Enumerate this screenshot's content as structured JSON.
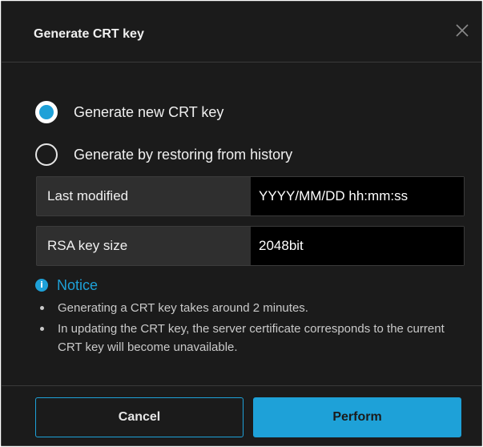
{
  "dialog": {
    "title": "Generate CRT key",
    "close_icon": "close-icon",
    "options": [
      {
        "label": "Generate new CRT key",
        "selected": true
      },
      {
        "label": "Generate by restoring from history",
        "selected": false
      }
    ],
    "fields": [
      {
        "label": "Last modified",
        "value": "YYYY/MM/DD hh:mm:ss"
      },
      {
        "label": "RSA key size",
        "value": "2048bit"
      }
    ],
    "notice": {
      "icon": "info-icon",
      "icon_glyph": "i",
      "title": "Notice",
      "items": [
        "Generating a CRT key takes around 2 minutes.",
        "In updating the CRT key, the server certificate corresponds to the current CRT key will become unavailable."
      ]
    },
    "buttons": {
      "cancel": "Cancel",
      "perform": "Perform"
    }
  },
  "colors": {
    "accent": "#1ea1d8",
    "background": "#1b1b1b",
    "field_label_bg": "#2f2f2f",
    "field_value_bg": "#000000"
  }
}
